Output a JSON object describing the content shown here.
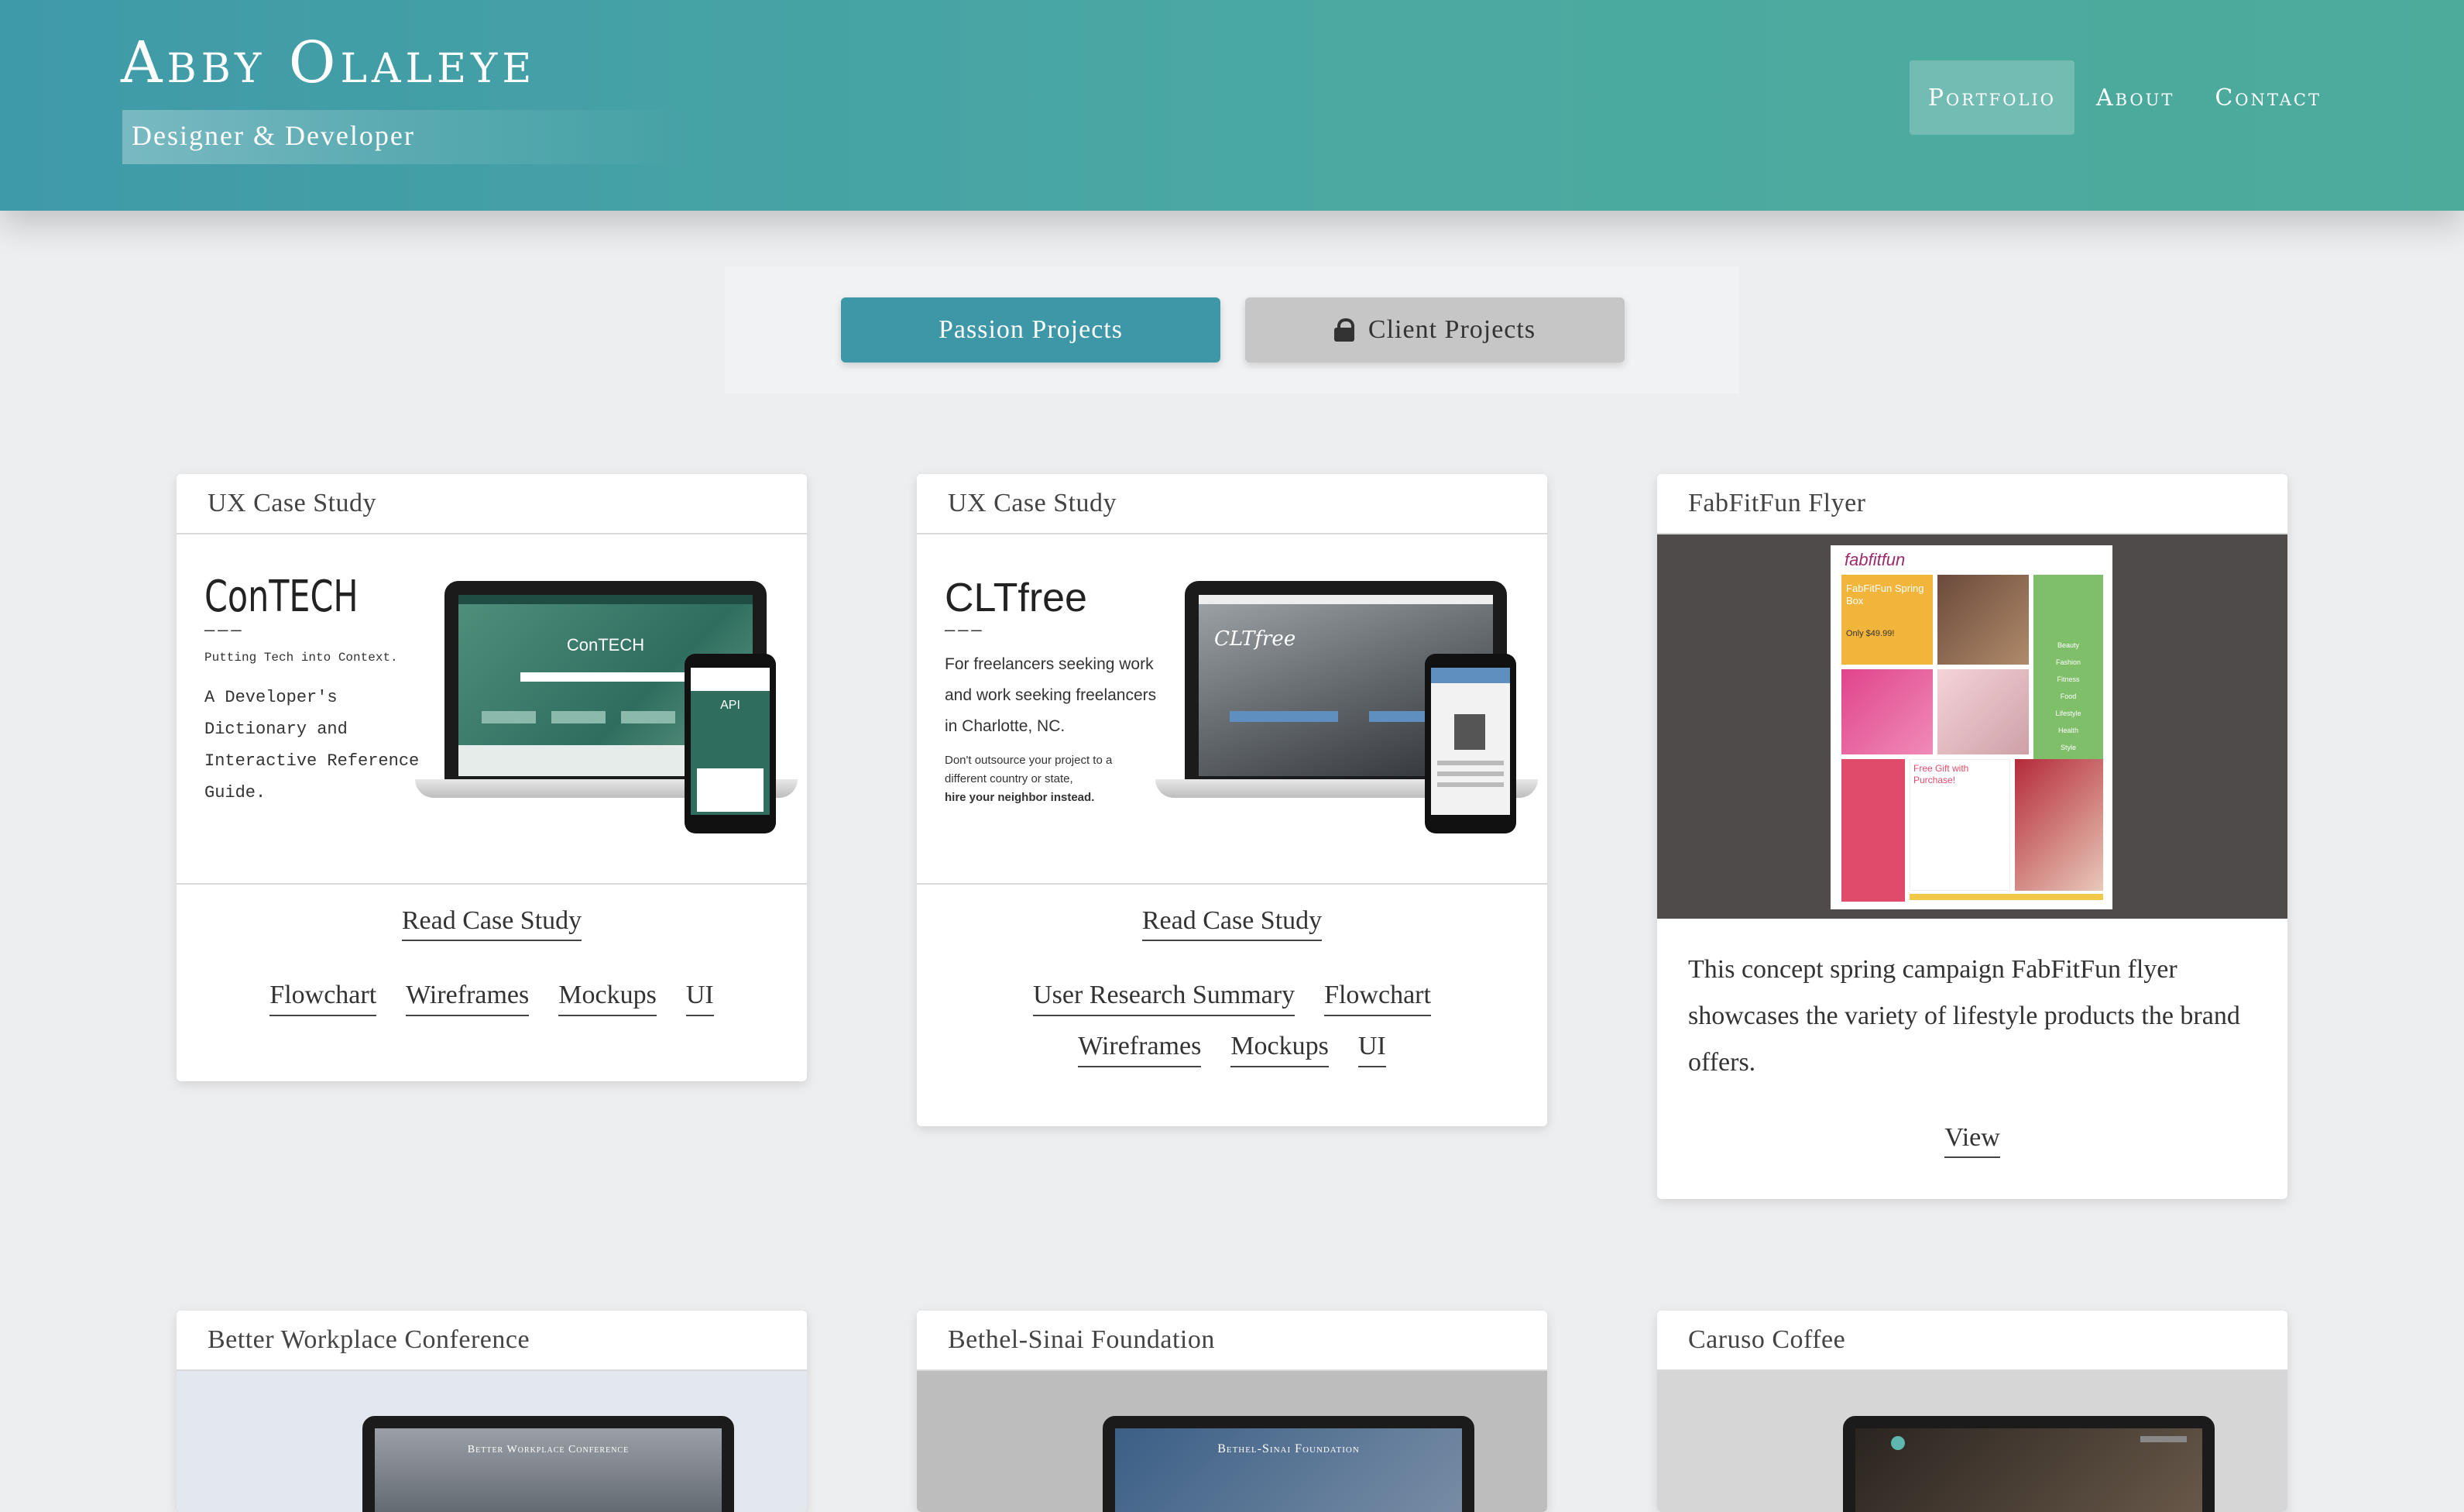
{
  "header": {
    "site_name": "Abby Olaleye",
    "tagline": "Designer & Developer",
    "nav": [
      "Portfolio",
      "About",
      "Contact"
    ],
    "active_nav": "Portfolio"
  },
  "toggle": {
    "passion": "Passion Projects",
    "client": "Client Projects"
  },
  "cards": [
    {
      "title": "UX Case Study",
      "image": {
        "heading": "ConTECH",
        "dashes": "———",
        "subtitle": "Putting Tech into Context.",
        "body": [
          "A Developer's",
          "Dictionary and",
          "Interactive Reference",
          "Guide."
        ],
        "screen_title": "ConTECH",
        "phone_title": "API"
      },
      "primary_link": "Read Case Study",
      "tags": [
        "Flowchart",
        "Wireframes",
        "Mockups",
        "UI"
      ]
    },
    {
      "title": "UX Case Study",
      "image": {
        "heading": "CLTfree",
        "dashes": "———",
        "body": [
          "For freelancers seeking work",
          "and work seeking freelancers",
          "in Charlotte, NC."
        ],
        "small": [
          "Don't outsource your project to a",
          "different country or state,"
        ],
        "small_bold": "hire your neighbor instead.",
        "screen_title": "CLTfree"
      },
      "primary_link": "Read Case Study",
      "tags": [
        "User Research Summary",
        "Flowchart",
        "Wireframes",
        "Mockups",
        "UI"
      ]
    },
    {
      "title": "FabFitFun Flyer",
      "flyer": {
        "brand": "fabfitfun",
        "box_title": "FabFitFun Spring Box",
        "price": "Only $49.99!",
        "categories": [
          "Beauty",
          "Fashion",
          "Fitness",
          "Food",
          "Lifestyle",
          "Health",
          "Style"
        ],
        "gift": "Free Gift with Purchase!"
      },
      "description": "This concept spring campaign FabFitFun flyer showcases the variety of lifestyle products the brand offers.",
      "primary_link": "View"
    },
    {
      "title": "Better Workplace Conference",
      "screen_text": "Better Workplace Conference"
    },
    {
      "title": "Bethel-Sinai Foundation",
      "screen_text": "Bethel-Sinai Foundation"
    },
    {
      "title": "Caruso Coffee"
    }
  ],
  "colors": {
    "header_start": "#3f9aa8",
    "header_end": "#4cab9b",
    "primary_button": "#3e97a7",
    "secondary_button": "#c6c6c7",
    "page_bg": "#edeef0"
  }
}
